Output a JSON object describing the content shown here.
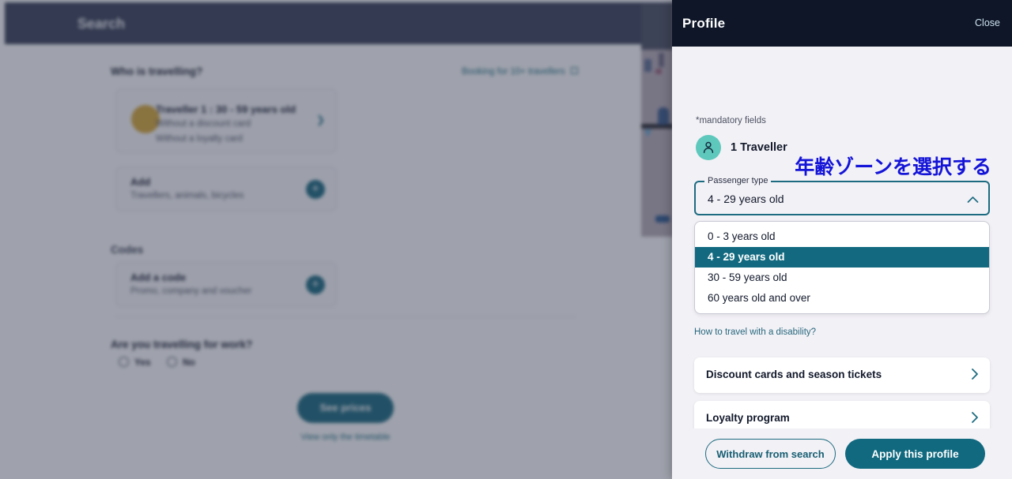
{
  "search_page": {
    "topbar_title": "Search",
    "section_who": "Who is travelling?",
    "booking_link": "Booking for 10+ travellers",
    "booking_link_icon": "external-link-icon",
    "traveller": {
      "title": "Traveller 1 :   30 - 59 years old",
      "line1": "Without a discount card",
      "line2": "Without a loyalty card"
    },
    "add_card": {
      "title": "Add",
      "subtitle": "Travellers, animals, bicycles",
      "icon": "plus-circle-icon"
    },
    "codes_heading": "Codes",
    "code_card": {
      "title": "Add a code",
      "subtitle": "Promo, company and voucher",
      "icon": "plus-circle-icon"
    },
    "work_question": "Are you travelling for work?",
    "work_options": [
      "Yes",
      "No"
    ],
    "see_prices_label": "See prices",
    "timetable_link": "View only the timetable"
  },
  "profile_panel": {
    "header": {
      "title": "Profile",
      "close_label": "Close"
    },
    "mandatory_note": "*mandatory fields",
    "traveller_count_label": "1 Traveller",
    "avatar_icon": "person-icon",
    "annotation_jp": "年齢ゾーンを選択する",
    "passenger_type": {
      "field_label": "Passenger type",
      "selected_value": "4 - 29 years old",
      "chevron_icon": "chevron-up-icon",
      "options": [
        "0 - 3 years old",
        "4 - 29 years old",
        "30 - 59 years old",
        "60 years old and over"
      ],
      "selected_index": 1
    },
    "disability_link": "How to travel with a disability?",
    "nav_cards": [
      {
        "label": "Discount cards and season tickets",
        "chevron_icon": "chevron-right-icon"
      },
      {
        "label": "Loyalty program",
        "chevron_icon": "chevron-right-icon"
      }
    ],
    "footer": {
      "withdraw_label": "Withdraw from search",
      "apply_label": "Apply this profile"
    }
  },
  "colors": {
    "panel_bg": "#f2f1f6",
    "header_bg": "#0e1627",
    "accent_teal": "#136a80",
    "annotation_blue": "#1414d8",
    "avatar_mint": "#5ec8bd",
    "search_topbar": "#3b4259"
  }
}
